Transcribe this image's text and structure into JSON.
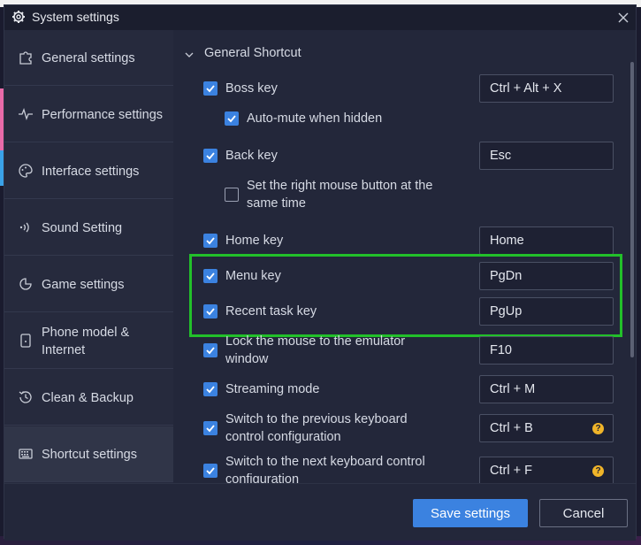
{
  "window": {
    "title": "System settings"
  },
  "sidebar": {
    "items": [
      {
        "label": "General settings",
        "icon": "puzzle-icon"
      },
      {
        "label": "Performance settings",
        "icon": "pulse-icon"
      },
      {
        "label": "Interface settings",
        "icon": "palette-icon"
      },
      {
        "label": "Sound Setting",
        "icon": "sound-waves-icon"
      },
      {
        "label": "Game settings",
        "icon": "gamepad-icon"
      },
      {
        "label": "Phone model & Internet",
        "icon": "phone-icon"
      },
      {
        "label": "Clean & Backup",
        "icon": "history-icon"
      },
      {
        "label": "Shortcut settings",
        "icon": "keyboard-icon",
        "active": true
      }
    ]
  },
  "section": {
    "title": "General Shortcut"
  },
  "rows": [
    {
      "label": "Boss key",
      "checked": true,
      "key": "Ctrl + Alt + X"
    },
    {
      "label": "Auto-mute when hidden",
      "checked": true
    },
    {
      "label": "Back key",
      "checked": true,
      "key": "Esc"
    },
    {
      "label": "Set the right mouse button at the same time",
      "checked": false
    },
    {
      "label": "Home key",
      "checked": true,
      "key": "Home"
    },
    {
      "label": "Menu key",
      "checked": true,
      "key": "PgDn"
    },
    {
      "label": "Recent task key",
      "checked": true,
      "key": "PgUp"
    },
    {
      "label": "Lock the mouse to the emulator window",
      "checked": true,
      "key": "F10"
    },
    {
      "label": "Streaming mode",
      "checked": true,
      "key": "Ctrl + M"
    },
    {
      "label": "Switch to the previous keyboard control configuration",
      "checked": true,
      "key": "Ctrl + B",
      "help": "?"
    },
    {
      "label": "Switch to the next keyboard control configuration",
      "checked": true,
      "key": "Ctrl + F",
      "help": "?"
    }
  ],
  "footer": {
    "save_label": "Save settings",
    "cancel_label": "Cancel"
  },
  "colors": {
    "accent": "#3b82e0",
    "highlight": "#22c02a",
    "help": "#f0b429"
  }
}
